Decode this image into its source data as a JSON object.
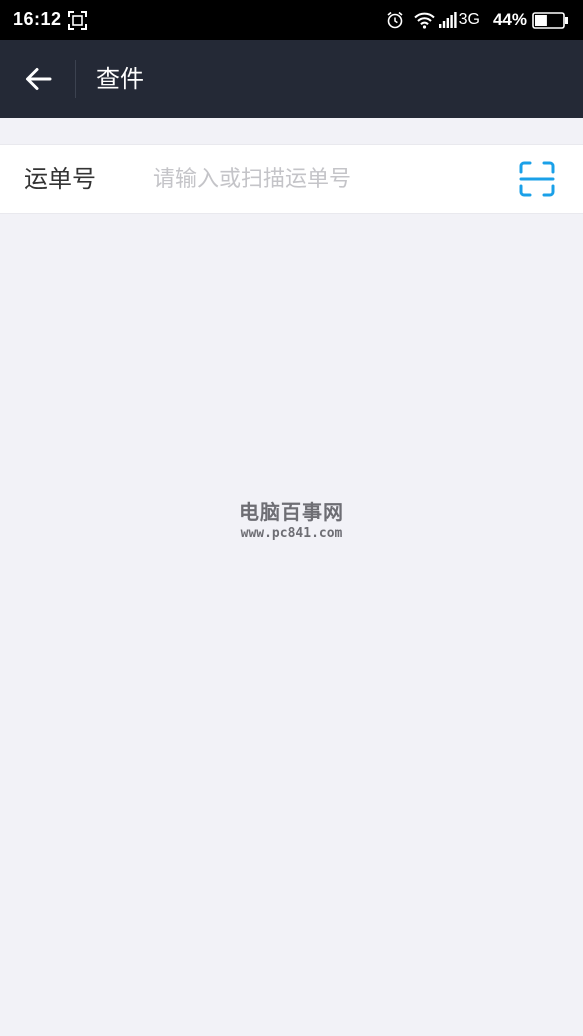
{
  "status_bar": {
    "time": "16:12",
    "network": "3G",
    "battery_percent": "44%",
    "icons": [
      "screenshot-icon",
      "alarm-icon",
      "wifi-icon",
      "signal-icon",
      "battery-icon"
    ]
  },
  "header": {
    "title": "查件",
    "back_icon": "arrow-left-icon"
  },
  "waybill": {
    "label": "运单号",
    "value": "",
    "placeholder": "请输入或扫描运单号",
    "scan_icon": "scan-frame-icon"
  },
  "watermark": {
    "title": "电脑百事网",
    "url": "www.pc841.com"
  },
  "colors": {
    "status_bar_bg": "#000000",
    "header_bg": "#242936",
    "page_bg": "#f2f2f7",
    "accent": "#1aa0e8",
    "placeholder": "#c4c4c8"
  }
}
